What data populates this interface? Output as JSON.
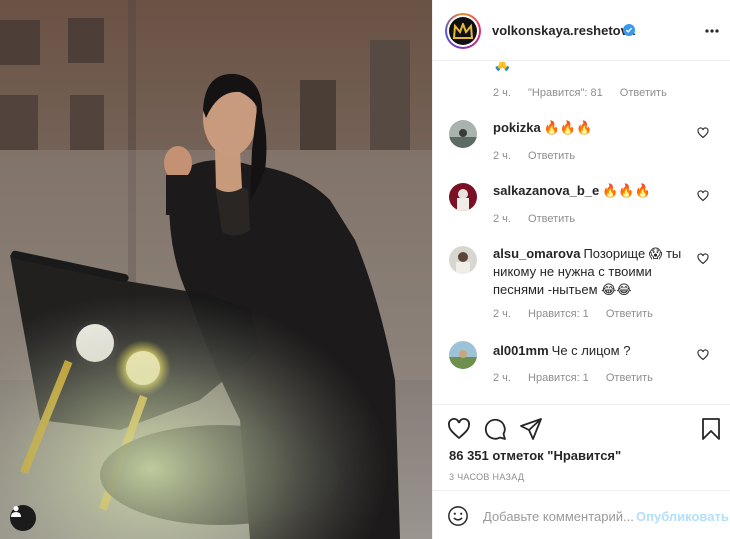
{
  "post": {
    "username": "volkonskaya.reshetova",
    "likes": "86 351 отметок \"Нравится\"",
    "time_ago": "3 часов назад"
  },
  "top_reply": {
    "emoji": "🙏",
    "time": "2 ч.",
    "likes": "\"Нравится\": 81",
    "reply": "Ответить"
  },
  "comments": [
    {
      "user": "pokizka",
      "text": "🔥🔥🔥",
      "time": "2 ч.",
      "likes": "",
      "reply": "Ответить"
    },
    {
      "user": "salkazanova_b_e",
      "text": "🔥🔥🔥",
      "time": "2 ч.",
      "likes": "",
      "reply": "Ответить"
    },
    {
      "user": "alsu_omarova",
      "text": "Позорище 😱 ты никому не нужна с твоими песнями -нытьем 😂😂",
      "time": "2 ч.",
      "likes": "Нравится: 1",
      "reply": "Ответить"
    },
    {
      "user": "al001mm",
      "text": "Че с лицом ?",
      "time": "2 ч.",
      "likes": "Нравится: 1",
      "reply": "Ответить"
    }
  ],
  "composer": {
    "placeholder": "Добавьте комментарий...",
    "publish": "Опубликовать"
  },
  "icons": {
    "verified": "verified-badge-icon",
    "more": "more-options-icon",
    "like": "heart-icon",
    "comment": "comment-icon",
    "share": "share-icon",
    "save": "bookmark-icon",
    "emoji": "emoji-icon",
    "user_tag": "user-tag-icon"
  },
  "colors": {
    "verified": "#3897f0",
    "link_disabled": "#b2dffc",
    "muted": "#8e8e8e",
    "text": "#262626"
  }
}
